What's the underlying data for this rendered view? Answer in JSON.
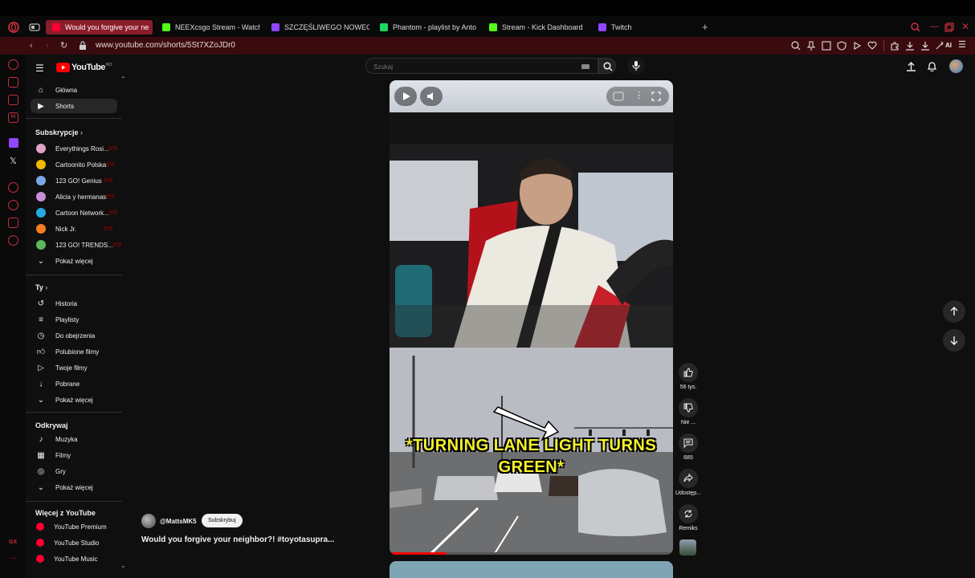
{
  "browser": {
    "tabs": [
      {
        "label": "Would you forgive your ne",
        "active": true,
        "favicon_color": "#ff0033"
      },
      {
        "label": "NEEXcsgo Stream - Watch",
        "active": false,
        "favicon_color": "#53fc18"
      },
      {
        "label": "SZCZĘŚLIWEGO NOWEGO",
        "active": false,
        "favicon_color": "#9146ff"
      },
      {
        "label": "Phantom - playlist by Anto",
        "active": false,
        "favicon_color": "#1ed760"
      },
      {
        "label": "Stream - Kick Dashboard",
        "active": false,
        "favicon_color": "#53fc18"
      },
      {
        "label": "Twitch",
        "active": false,
        "favicon_color": "#9146ff"
      }
    ],
    "url": "www.youtube.com/shorts/5St7XZoJDr0",
    "ai_label": "AI",
    "rail_label_gx": "GX"
  },
  "youtube": {
    "logo": "YouTube",
    "logo_region": "NO",
    "search_placeholder": "Szukaj",
    "nav_main": [
      {
        "label": "Główna",
        "icon": "home-icon"
      },
      {
        "label": "Shorts",
        "icon": "shorts-icon",
        "selected": true
      }
    ],
    "subs_heading": "Subskrypcje",
    "subscriptions": [
      {
        "label": "Everythings Rosi...",
        "color": "#e0a3c8"
      },
      {
        "label": "Cartoonito Polska",
        "color": "#f2b705"
      },
      {
        "label": "123 GO! Genius",
        "color": "#7aa7e8"
      },
      {
        "label": "Alicia y hermanas",
        "color": "#c98fd6"
      },
      {
        "label": "Cartoon Network...",
        "color": "#27a9e1"
      },
      {
        "label": "Nick Jr.",
        "color": "#f57c1f"
      },
      {
        "label": "123 GO! TRENDS...",
        "color": "#5cb85c"
      }
    ],
    "show_more": "Pokaż więcej",
    "you_heading": "Ty",
    "you_items": [
      {
        "label": "Historia",
        "icon": "history-icon"
      },
      {
        "label": "Playlisty",
        "icon": "playlist-icon"
      },
      {
        "label": "Do obejrzenia",
        "icon": "watch-later-icon"
      },
      {
        "label": "Polubione filmy",
        "icon": "like-icon"
      },
      {
        "label": "Twoje filmy",
        "icon": "your-videos-icon"
      },
      {
        "label": "Pobrane",
        "icon": "download-icon"
      },
      {
        "label": "Pokaż więcej",
        "icon": "chevron-down-icon"
      }
    ],
    "explore_heading": "Odkrywaj",
    "explore_items": [
      {
        "label": "Muzyka",
        "icon": "music-icon"
      },
      {
        "label": "Filmy",
        "icon": "film-icon"
      },
      {
        "label": "Gry",
        "icon": "gaming-icon"
      },
      {
        "label": "Pokaż więcej",
        "icon": "chevron-down-icon"
      }
    ],
    "more_heading": "Więcej z YouTube",
    "more_items": [
      {
        "label": "YouTube Premium"
      },
      {
        "label": "YouTube Studio"
      },
      {
        "label": "YouTube Music"
      }
    ]
  },
  "short": {
    "caption": "*TURNING LANE LIGHT TURNS GREEN*",
    "channel": "@MattsMK5",
    "subscribe": "Subskrybuj",
    "title": "Would you forgive your neighbor?! #toyotasupra...",
    "likes": "56 tys.",
    "dislike": "Nie ...",
    "comments": "685",
    "share": "Udostęp...",
    "remix": "Remiks",
    "progress": 0.2
  },
  "colors": {
    "accent_red": "#c6303b",
    "address_bg": "#3a0b0e",
    "active_tab": "#8b1d2a",
    "caption_yellow": "#f3f22a"
  }
}
